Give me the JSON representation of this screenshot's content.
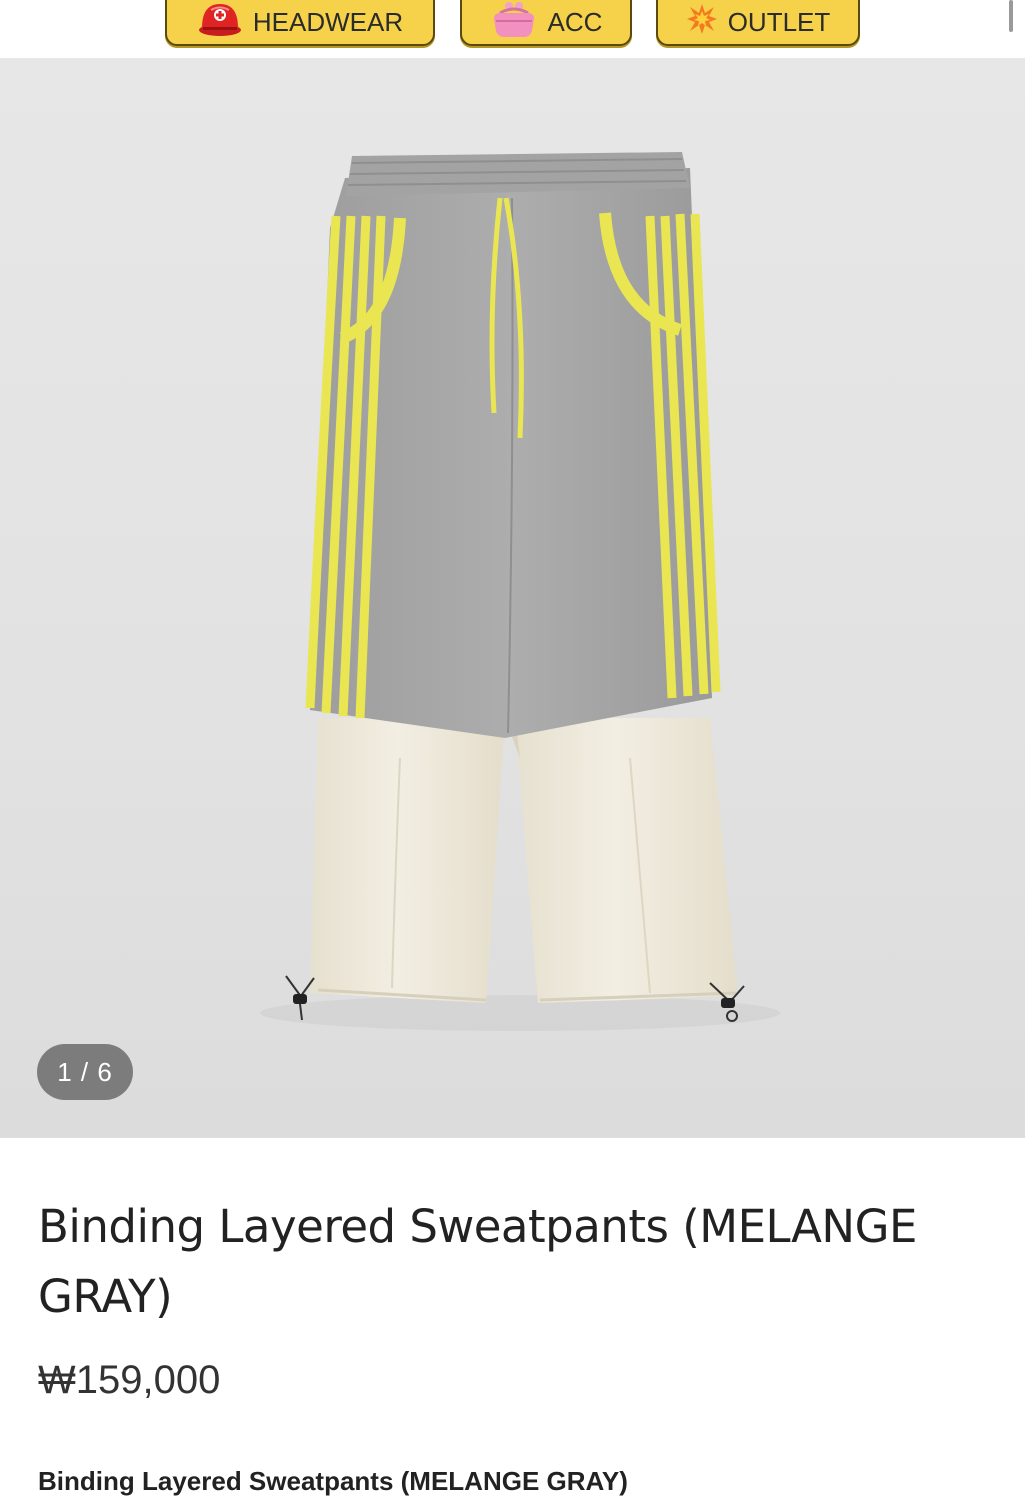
{
  "nav": {
    "items": [
      {
        "label": "HEADWEAR",
        "icon": "helmet-icon"
      },
      {
        "label": "ACC",
        "icon": "purse-icon"
      },
      {
        "label": "OUTLET",
        "icon": "burst-icon"
      }
    ]
  },
  "gallery": {
    "counter": "1 / 6"
  },
  "product": {
    "title": "Binding Layered Sweatpants (MELANGE GRAY)",
    "price": "₩159,000",
    "subtitle": "Binding Layered Sweatpants (MELANGE GRAY)"
  },
  "colors": {
    "nav_button": "#f6d24a",
    "nav_border": "#5a4a10",
    "pants_gray": "#a6a6a6",
    "stripe_yellow": "#e9e651",
    "cream_layer": "#efeadb"
  }
}
